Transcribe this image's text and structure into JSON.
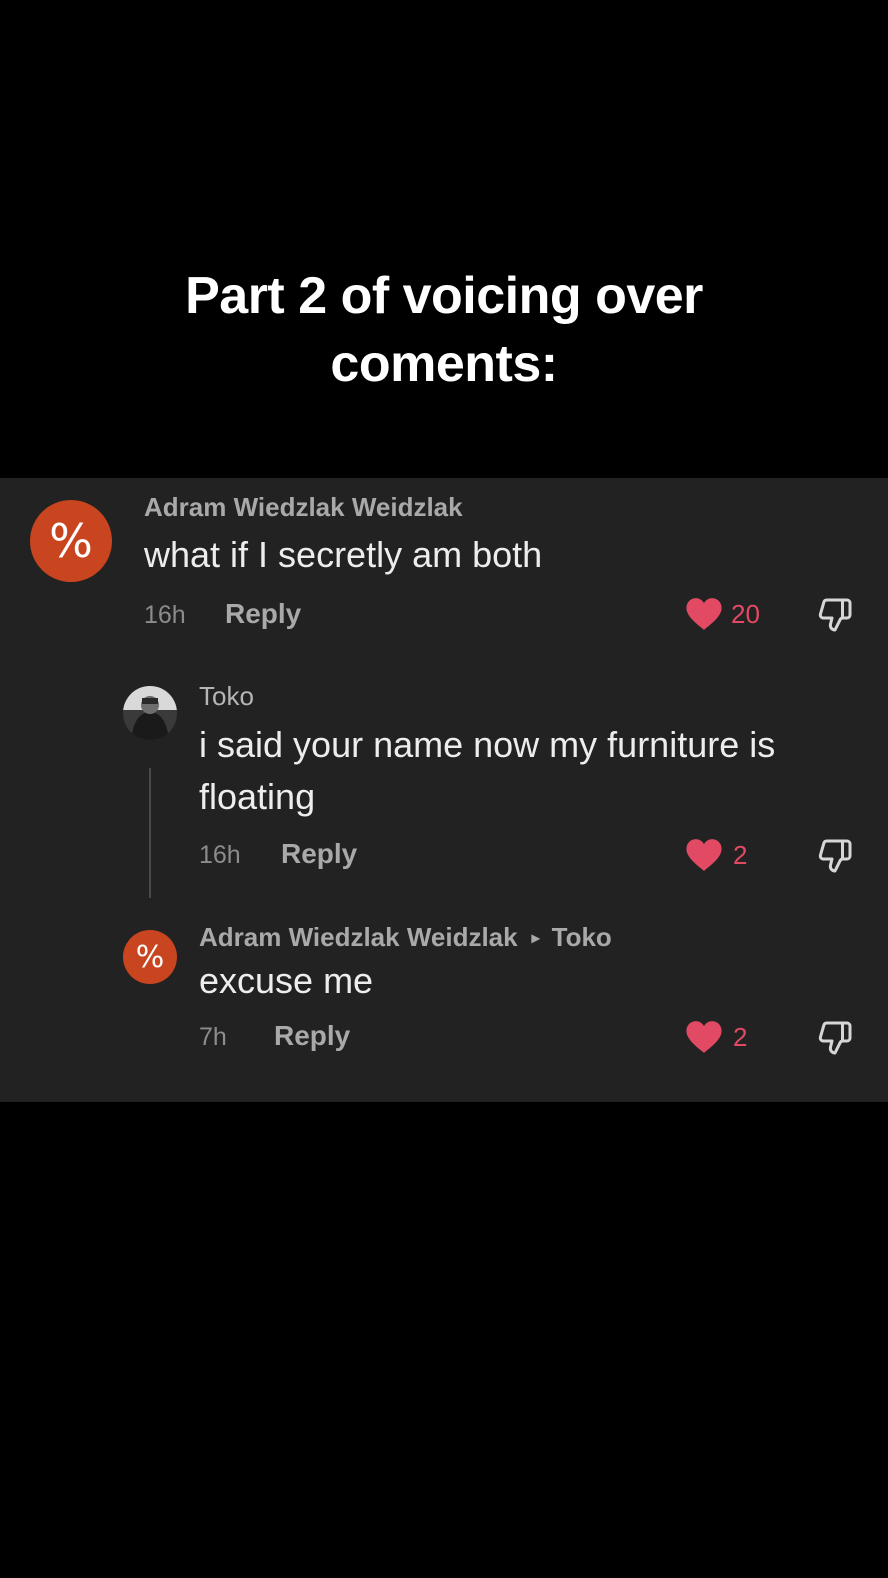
{
  "overlay": {
    "line1": "Part 2 of voicing over",
    "line2": "coments:"
  },
  "colors": {
    "page_background": "#000000",
    "panel_background": "#222222",
    "avatar_orange": "#c8451f",
    "like_red": "#e24a64"
  },
  "comments": [
    {
      "avatar_glyph": "%",
      "username": "Adram Wiedzlak Weidzlak",
      "text": "what if I secretly am both",
      "time": "16h",
      "reply_label": "Reply",
      "likes": "20"
    },
    {
      "avatar_icon": "photo-avatar",
      "username": "Toko",
      "text_line1": "i said your name now my furniture is",
      "text_line2": "floating",
      "time": "16h",
      "reply_label": "Reply",
      "likes": "2"
    },
    {
      "avatar_glyph": "%",
      "username": "Adram Wiedzlak Weidzlak",
      "reply_to_arrow": "▸",
      "reply_to": "Toko",
      "text": "excuse me",
      "time": "7h",
      "reply_label": "Reply",
      "likes": "2"
    }
  ]
}
